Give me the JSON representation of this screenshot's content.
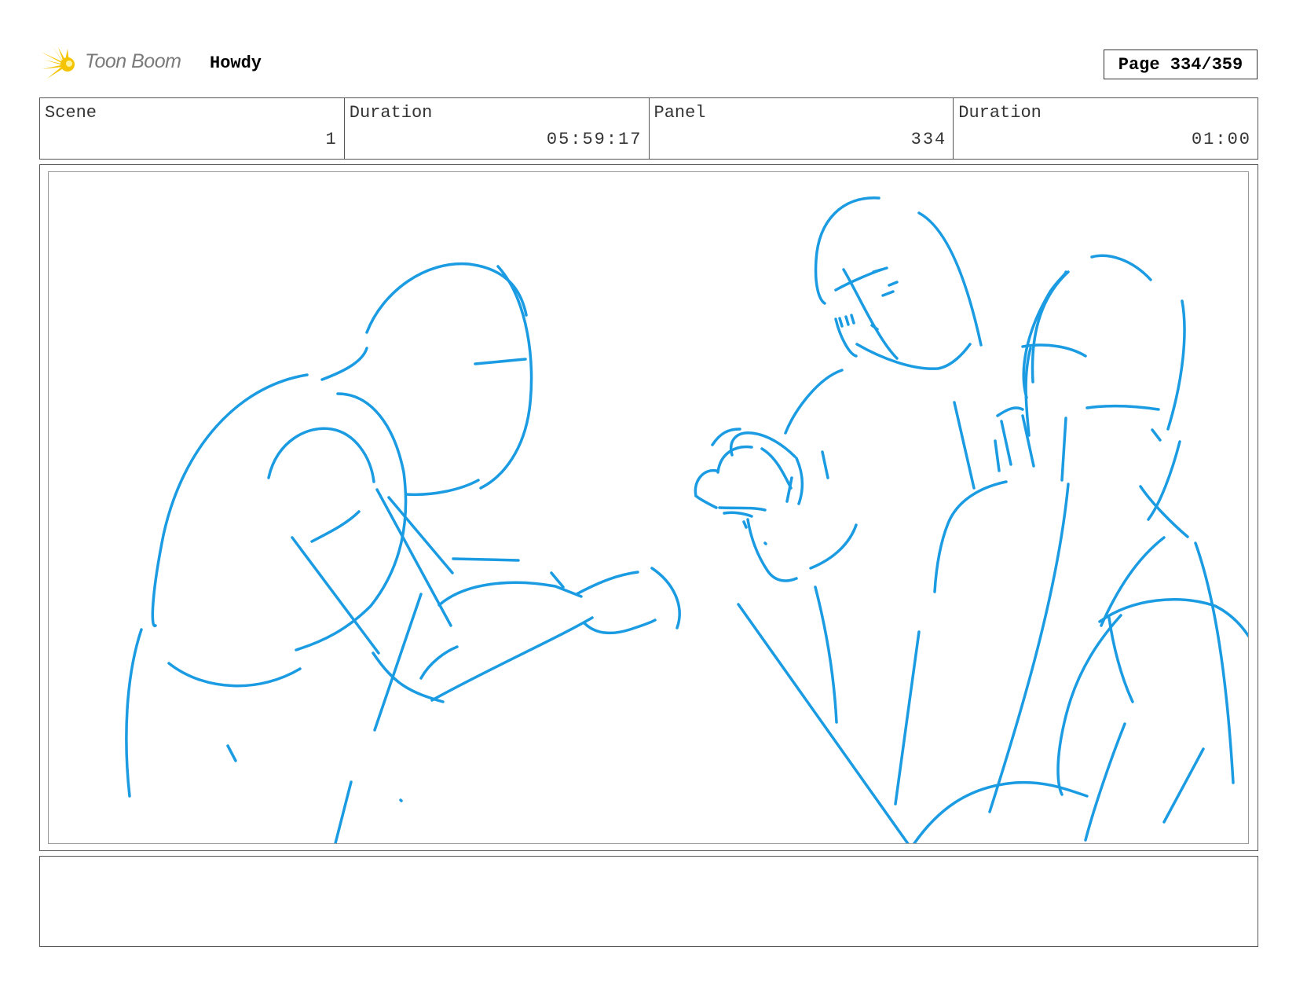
{
  "header": {
    "logo_text": "Toon Boom",
    "project_title": "Howdy",
    "page_label": "Page 334/359"
  },
  "info": {
    "scene_label": "Scene",
    "scene_value": "1",
    "scene_duration_label": "Duration",
    "scene_duration_value": "05:59:17",
    "panel_label": "Panel",
    "panel_value": "334",
    "panel_duration_label": "Duration",
    "panel_duration_value": "01:00"
  },
  "colors": {
    "sketch_line": "#1a9be2",
    "logo_flare": "#f5c400"
  },
  "icons": {
    "logo": "toon-boom-flare-icon"
  }
}
